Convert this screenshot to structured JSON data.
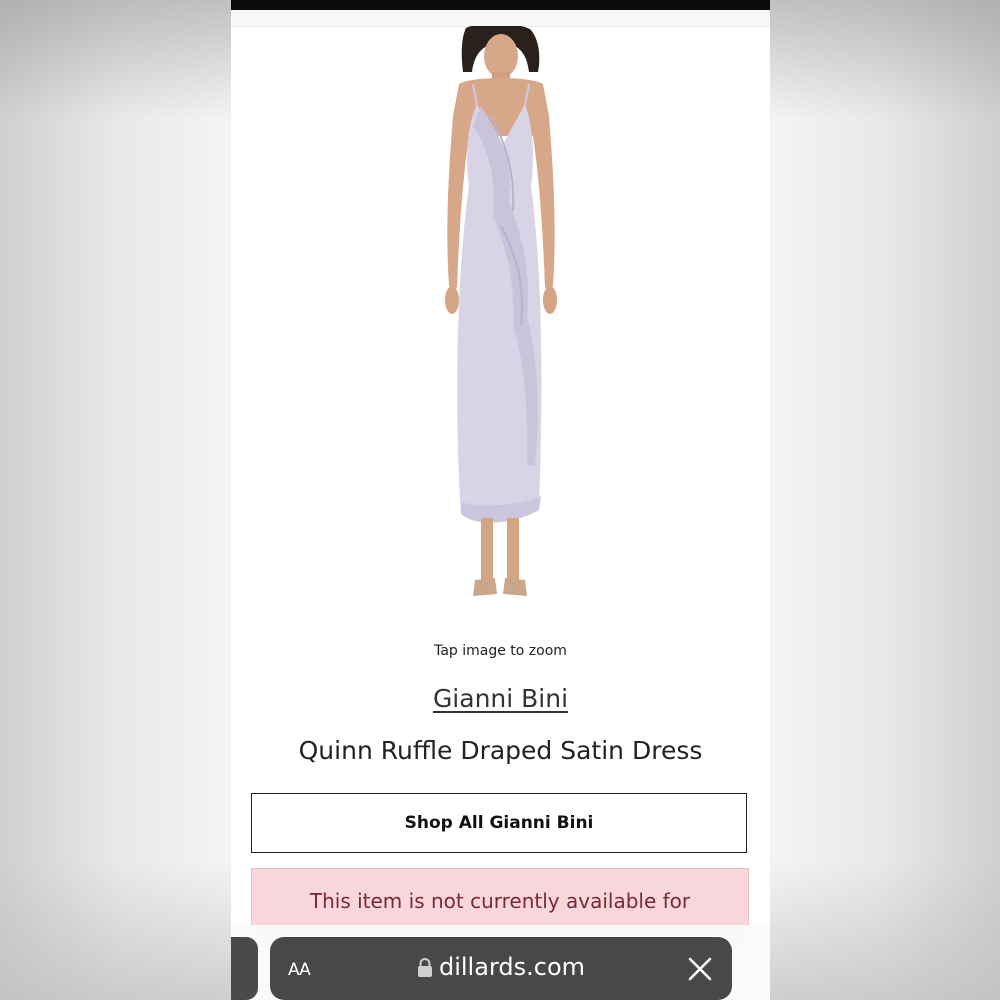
{
  "product": {
    "zoom_hint": "Tap image to zoom",
    "brand": "Gianni Bini",
    "title": "Quinn Ruffle Draped Satin Dress",
    "image_icon": "dress-photo",
    "dress_color": "#d8d4e6"
  },
  "actions": {
    "shop_all_label": "Shop All Gianni Bini"
  },
  "availability": {
    "message": "This item is not currently available for"
  },
  "browser": {
    "text_size_label": "AA",
    "url": "dillards.com",
    "icons": [
      "lock-icon",
      "close-icon"
    ]
  }
}
